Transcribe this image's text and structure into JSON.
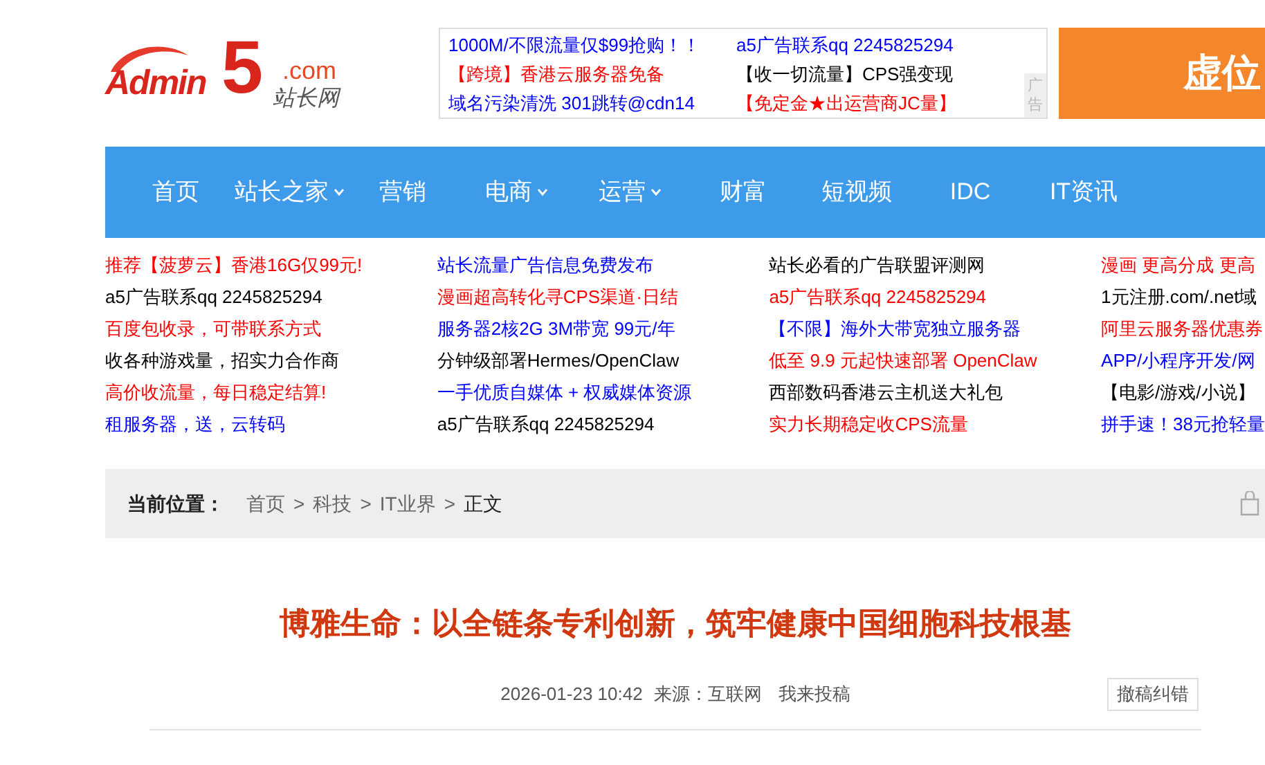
{
  "logo": {
    "letters": "Admin",
    "digit": "5",
    "domain": ".com",
    "name": "站长网"
  },
  "top_ads": {
    "links": [
      {
        "text": "1000M/不限流量仅$99抢购！！",
        "color": "#0000ff"
      },
      {
        "text": "a5广告联系qq 2245825294",
        "color": "#0000ff"
      },
      {
        "text": "【跨境】香港云服务器免备",
        "color": "#ff0000"
      },
      {
        "text": "【收一切流量】CPS强变现",
        "color": "#000000"
      },
      {
        "text": "域名污染清洗 301跳转@cdn14",
        "color": "#0000ff"
      },
      {
        "text": "【免定金★出运营商JC量】",
        "color": "#ff0000"
      }
    ],
    "ad_label": "广告"
  },
  "banner": {
    "text": "虚位"
  },
  "nav": [
    {
      "label": "首页",
      "dropdown": false
    },
    {
      "label": "站长之家",
      "dropdown": true
    },
    {
      "label": "营销",
      "dropdown": false
    },
    {
      "label": "电商",
      "dropdown": true
    },
    {
      "label": "运营",
      "dropdown": true
    },
    {
      "label": "财富",
      "dropdown": false
    },
    {
      "label": "短视频",
      "dropdown": false
    },
    {
      "label": "IDC",
      "dropdown": false
    },
    {
      "label": "IT资讯",
      "dropdown": false
    }
  ],
  "ad_columns": [
    [
      {
        "text": "推荐【菠萝云】香港16G仅99元!",
        "color": "#ff0000"
      },
      {
        "text": "a5广告联系qq 2245825294",
        "color": "#000000"
      },
      {
        "text": "百度包收录，可带联系方式",
        "color": "#ff0000"
      },
      {
        "text": "收各种游戏量，招实力合作商",
        "color": "#000000"
      },
      {
        "text": "高价收流量，每日稳定结算!",
        "color": "#ff0000"
      },
      {
        "text": "租服务器，送，云转码",
        "color": "#0000ff"
      }
    ],
    [
      {
        "text": "站长流量广告信息免费发布",
        "color": "#0000ff"
      },
      {
        "text": "漫画超高转化寻CPS渠道·日结",
        "color": "#ff0000"
      },
      {
        "text": "服务器2核2G 3M带宽 99元/年",
        "color": "#0000ff"
      },
      {
        "text": "分钟级部署Hermes/OpenClaw",
        "color": "#000000"
      },
      {
        "text": "一手优质自媒体 + 权威媒体资源",
        "color": "#0000ff"
      },
      {
        "text": "a5广告联系qq 2245825294",
        "color": "#000000"
      }
    ],
    [
      {
        "text": "站长必看的广告联盟评测网",
        "color": "#000000"
      },
      {
        "text": "a5广告联系qq 2245825294",
        "color": "#ff0000"
      },
      {
        "text": "【不限】海外大带宽独立服务器",
        "color": "#0000ff"
      },
      {
        "text": "低至 9.9 元起快速部署 OpenClaw",
        "color": "#ff0000"
      },
      {
        "text": "西部数码香港云主机送大礼包",
        "color": "#000000"
      },
      {
        "text": "实力长期稳定收CPS流量",
        "color": "#ff0000"
      }
    ],
    [
      {
        "text": "漫画 更高分成 更高",
        "color": "#ff0000"
      },
      {
        "text": "1元注册.com/.net域",
        "color": "#000000"
      },
      {
        "text": "阿里云服务器优惠券",
        "color": "#ff0000"
      },
      {
        "text": "APP/小程序开发/网",
        "color": "#0000ff"
      },
      {
        "text": "【电影/游戏/小说】",
        "color": "#000000"
      },
      {
        "text": "拼手速！38元抢轻量",
        "color": "#0000ff"
      }
    ]
  ],
  "breadcrumb": {
    "label": "当前位置：",
    "items": [
      {
        "text": "首页",
        "separator": ">"
      },
      {
        "text": "科技",
        "separator": ">"
      },
      {
        "text": "IT业界",
        "separator": ">"
      },
      {
        "text": "正文"
      }
    ]
  },
  "article": {
    "title": "博雅生命：以全链条专利创新，筑牢健康中国细胞科技根基",
    "date": "2026-01-23 10:42",
    "source": "来源：互联网",
    "submit": "我来投稿",
    "report_button": "撤稿纠错"
  }
}
